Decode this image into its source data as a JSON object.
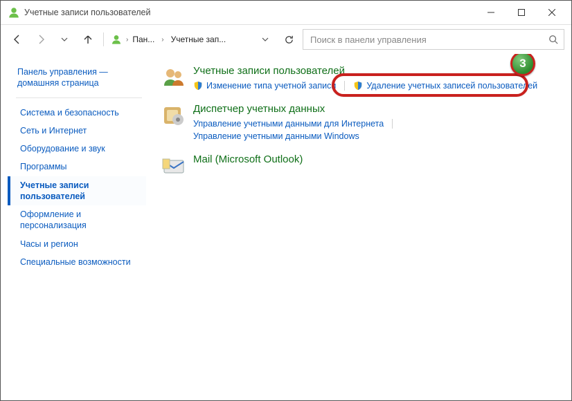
{
  "window_title": "Учетные записи пользователей",
  "breadcrumb": {
    "root": "Пан...",
    "current": "Учетные зап..."
  },
  "search": {
    "placeholder": "Поиск в панели управления"
  },
  "sidebar": {
    "home": "Панель управления — домашняя страница",
    "items": [
      {
        "label": "Система и безопасность"
      },
      {
        "label": "Сеть и Интернет"
      },
      {
        "label": "Оборудование и звук"
      },
      {
        "label": "Программы"
      },
      {
        "label": "Учетные записи пользователей",
        "active": true
      },
      {
        "label": "Оформление и персонализация"
      },
      {
        "label": "Часы и регион"
      },
      {
        "label": "Специальные возможности"
      }
    ]
  },
  "content": {
    "sections": [
      {
        "heading": "Учетные записи пользователей",
        "links": [
          {
            "label": "Изменение типа учетной записи",
            "shield": true
          },
          {
            "label": "Удаление учетных записей пользователей",
            "shield": true,
            "highlight": true
          }
        ]
      },
      {
        "heading": "Диспетчер учетных данных",
        "links": [
          {
            "label": "Управление учетными данными для Интернета"
          },
          {
            "label": "Управление учетными данными Windows"
          }
        ]
      },
      {
        "heading": "Mail (Microsoft Outlook)",
        "links": []
      }
    ]
  },
  "annotation": {
    "badge": "3"
  }
}
